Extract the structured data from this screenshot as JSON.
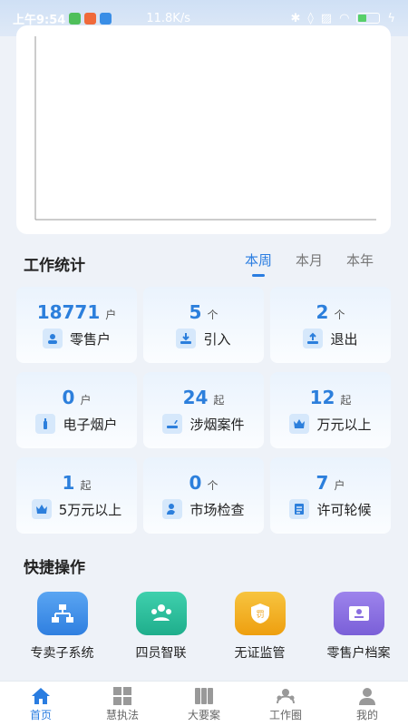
{
  "status_bar": {
    "time": "上午9:54",
    "network_speed": "11.8K/s",
    "battery_level": "33"
  },
  "stats": {
    "title": "工作统计",
    "period_tabs": [
      "本周",
      "本月",
      "本年"
    ],
    "active_period": "本周",
    "cards": [
      {
        "value": "18771",
        "unit": "户",
        "label": "零售户",
        "icon": "user-icon"
      },
      {
        "value": "5",
        "unit": "个",
        "label": "引入",
        "icon": "download-icon"
      },
      {
        "value": "2",
        "unit": "个",
        "label": "退出",
        "icon": "upload-icon"
      },
      {
        "value": "0",
        "unit": "户",
        "label": "电子烟户",
        "icon": "e-cigarette-icon"
      },
      {
        "value": "24",
        "unit": "起",
        "label": "涉烟案件",
        "icon": "cigarette-icon"
      },
      {
        "value": "12",
        "unit": "起",
        "label": "万元以上",
        "icon": "crown-icon"
      },
      {
        "value": "1",
        "unit": "起",
        "label": "5万元以上",
        "icon": "crown-icon"
      },
      {
        "value": "0",
        "unit": "个",
        "label": "市场检查",
        "icon": "inspector-icon"
      },
      {
        "value": "7",
        "unit": "户",
        "label": "许可轮候",
        "icon": "document-icon"
      }
    ]
  },
  "quick_actions": {
    "title": "快捷操作",
    "items": [
      {
        "label": "专卖子系统",
        "icon": "sitemap-icon",
        "color": "#3d8fe8"
      },
      {
        "label": "四员智联",
        "icon": "team-icon",
        "color": "#28b99a"
      },
      {
        "label": "无证监管",
        "icon": "shield-penalty-icon",
        "color": "#f2b21c"
      },
      {
        "label": "零售户档案",
        "icon": "profile-archive-icon",
        "color": "#8a6fe0"
      }
    ]
  },
  "bottom_nav": {
    "items": [
      {
        "label": "首页",
        "icon": "home-icon"
      },
      {
        "label": "慧执法",
        "icon": "grid-icon"
      },
      {
        "label": "大要案",
        "icon": "case-files-icon"
      },
      {
        "label": "工作圈",
        "icon": "work-circle-icon"
      },
      {
        "label": "我的",
        "icon": "person-icon"
      }
    ],
    "active": "首页"
  },
  "colors": {
    "accent": "#2a7de1",
    "background": "#eef2f8"
  }
}
